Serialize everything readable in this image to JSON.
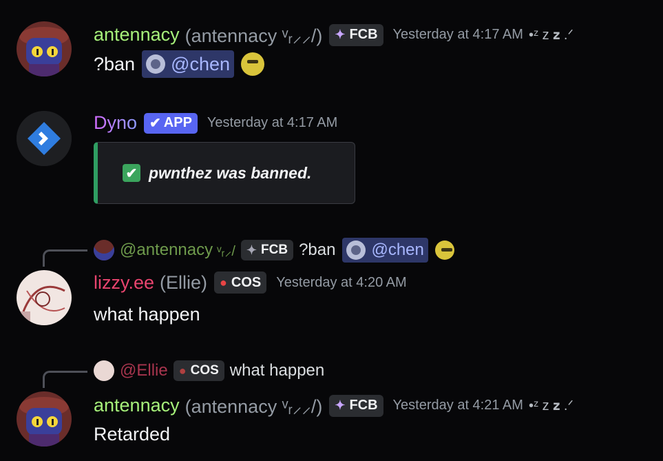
{
  "messages": [
    {
      "username": "antennacy",
      "display_name": "(antennacy ᵛᵣ⸝⸝/)",
      "tag": "FCB",
      "timestamp": "Yesterday at 4:17 AM",
      "decoration": "•ᶻ z 𝐳 .ᐟ",
      "content_text": "?ban",
      "mention": "@chen",
      "colors": {
        "username": "#a6f07a"
      }
    },
    {
      "username": "Dyno",
      "app_badge": "APP",
      "timestamp": "Yesterday at 4:17 AM",
      "embed_text": "pwnthez was banned.",
      "colors": {
        "username": "#b592ff"
      }
    },
    {
      "reply": {
        "username": "@antennacy",
        "decoration": "ᵛᵣ⸝/",
        "tag": "FCB",
        "text": "?ban",
        "mention": "@chen"
      },
      "username": "lizzy.ee",
      "display_name": "(Ellie)",
      "tag": "COS",
      "timestamp": "Yesterday at 4:20 AM",
      "content_text": "what happen",
      "colors": {
        "username": "#e8446e"
      }
    },
    {
      "reply": {
        "username": "@Ellie",
        "tag": "COS",
        "text": "what happen"
      },
      "username": "antennacy",
      "display_name": "(antennacy ᵛᵣ⸝⸝/)",
      "tag": "FCB",
      "timestamp": "Yesterday at 4:21 AM",
      "decoration": "•ᶻ z 𝐳 .ᐟ",
      "content_text": "Retarded",
      "colors": {
        "username": "#a6f07a"
      }
    }
  ]
}
